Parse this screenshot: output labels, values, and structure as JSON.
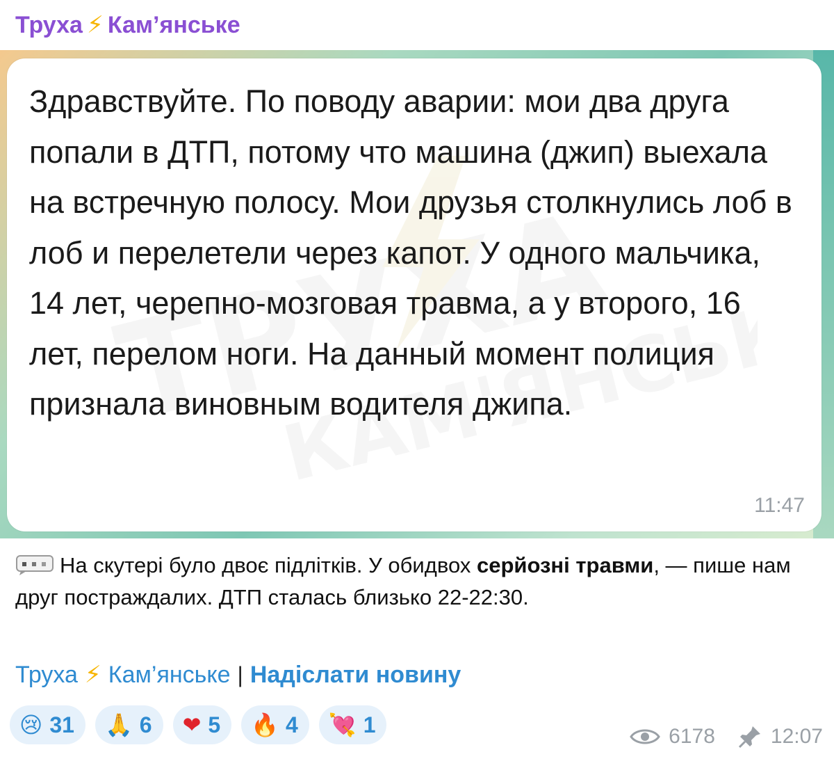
{
  "channel": {
    "name_left": "Труха",
    "name_right": "Кам’янське"
  },
  "message": {
    "text": "Здравствуйте. По поводу аварии: мои два друга попали в ДТП, потому что машина (джип) выехала на встречную полосу. Мои друзья столкнулись лоб в лоб и перелетели через капот. У одного мальчика, 14 лет, черепно-мозговая травма, а у второго, 16 лет, перелом ноги. На данный момент полиция признала виновным водителя джипа.",
    "time": "11:47"
  },
  "caption": {
    "part1": "На скутері було двоє підлітків. У обидвох ",
    "bold": "серйозні травми",
    "part2": ", — пише нам друг постраждалих. ДТП сталась близько 22-22:30."
  },
  "footer": {
    "channel_left": "Труха",
    "channel_right": "Кам’янське",
    "separator": "|",
    "send_news": "Надіслати новину"
  },
  "reactions": [
    {
      "emoji": "😢",
      "count": "31",
      "icon": "crying-face-icon"
    },
    {
      "emoji": "🙏",
      "count": "6",
      "icon": "folded-hands-icon"
    },
    {
      "emoji": "❤",
      "count": "5",
      "icon": "red-heart-icon"
    },
    {
      "emoji": "🔥",
      "count": "4",
      "icon": "fire-icon"
    },
    {
      "emoji": "💘",
      "count": "1",
      "icon": "heart-with-arrow-icon"
    }
  ],
  "meta": {
    "views": "6178",
    "time": "12:07"
  },
  "colors": {
    "channel_name": "#8a4fd3",
    "bolt": "#f7b500",
    "link": "#2f8bd1",
    "reaction_bg": "#e6f1fb",
    "meta_grey": "#9aa0a6"
  }
}
